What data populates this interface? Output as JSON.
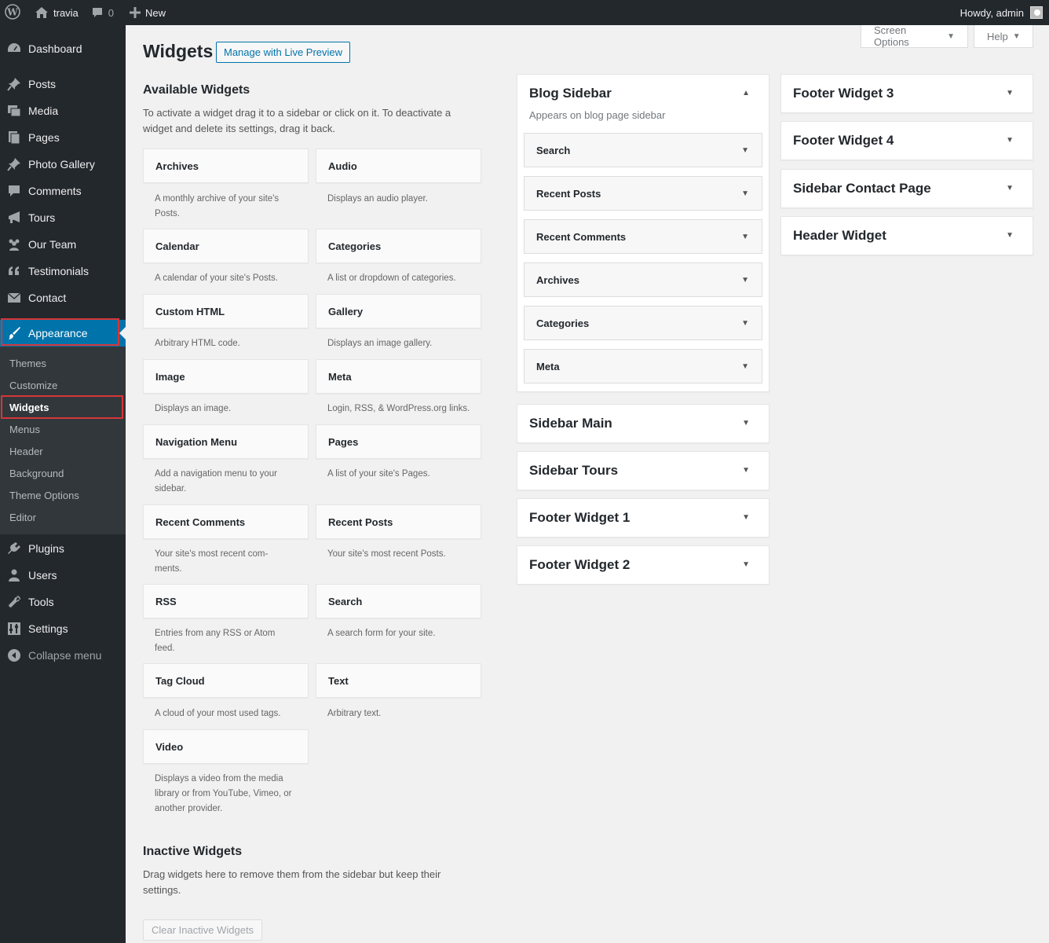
{
  "adminbar": {
    "site_name": "travia",
    "comments_count": "0",
    "new_label": "New",
    "howdy": "Howdy, admin"
  },
  "sidebar": {
    "items": [
      {
        "label": "Dashboard",
        "icon": "dashboard-icon"
      },
      {
        "label": "Posts",
        "icon": "pushpin-icon"
      },
      {
        "label": "Media",
        "icon": "media-icon"
      },
      {
        "label": "Pages",
        "icon": "pages-icon"
      },
      {
        "label": "Photo Gallery",
        "icon": "pushpin-icon"
      },
      {
        "label": "Comments",
        "icon": "comment-icon"
      },
      {
        "label": "Tours",
        "icon": "megaphone-icon"
      },
      {
        "label": "Our Team",
        "icon": "groups-icon"
      },
      {
        "label": "Testimonials",
        "icon": "quote-icon"
      },
      {
        "label": "Contact",
        "icon": "envelope-icon"
      },
      {
        "label": "Appearance",
        "icon": "paintbrush-icon"
      },
      {
        "label": "Plugins",
        "icon": "plugin-icon"
      },
      {
        "label": "Users",
        "icon": "user-icon"
      },
      {
        "label": "Tools",
        "icon": "wrench-icon"
      },
      {
        "label": "Settings",
        "icon": "settings-icon"
      },
      {
        "label": "Collapse menu",
        "icon": "collapse-icon"
      }
    ],
    "submenu": [
      "Themes",
      "Customize",
      "Widgets",
      "Menus",
      "Header",
      "Background",
      "Theme Options",
      "Editor"
    ]
  },
  "header": {
    "screen_options": "Screen Options",
    "help": "Help",
    "title": "Widgets",
    "live_preview": "Manage with Live Preview"
  },
  "available": {
    "title": "Available Widgets",
    "desc": "To activate a widget drag it to a sidebar or click on it. To deactivate a widget and delete its settings, drag it back.",
    "widgets": [
      {
        "name": "Archives",
        "desc": "A monthly archive of your site's Posts."
      },
      {
        "name": "Audio",
        "desc": "Displays an audio player."
      },
      {
        "name": "Calendar",
        "desc": "A calendar of your site's Posts."
      },
      {
        "name": "Categories",
        "desc": "A list or dropdown of categories."
      },
      {
        "name": "Custom HTML",
        "desc": "Arbitrary HTML code."
      },
      {
        "name": "Gallery",
        "desc": "Displays an image gallery."
      },
      {
        "name": "Image",
        "desc": "Displays an image."
      },
      {
        "name": "Meta",
        "desc": "Login, RSS, & WordPress.org links."
      },
      {
        "name": "Navigation Menu",
        "desc": "Add a navigation menu to your sidebar."
      },
      {
        "name": "Pages",
        "desc": "A list of your site's Pages."
      },
      {
        "name": "Recent Comments",
        "desc": "Your site's most recent com-ments."
      },
      {
        "name": "Recent Posts",
        "desc": "Your site's most recent Posts."
      },
      {
        "name": "RSS",
        "desc": "Entries from any RSS or Atom feed."
      },
      {
        "name": "Search",
        "desc": "A search form for your site."
      },
      {
        "name": "Tag Cloud",
        "desc": "A cloud of your most used tags."
      },
      {
        "name": "Text",
        "desc": "Arbitrary text."
      },
      {
        "name": "Video",
        "desc": "Displays a video from the media library or from YouTube, Vimeo, or another provider."
      }
    ]
  },
  "inactive": {
    "title": "Inactive Widgets",
    "desc": "Drag widgets here to remove them from the sidebar but keep their settings.",
    "clear_label": "Clear Inactive Widgets"
  },
  "sidebars_col1": [
    {
      "name": "Blog Sidebar",
      "desc": "Appears on blog page sidebar",
      "open": true,
      "widgets": [
        "Search",
        "Recent Posts",
        "Recent Comments",
        "Archives",
        "Categories",
        "Meta"
      ]
    },
    {
      "name": "Sidebar Main"
    },
    {
      "name": "Sidebar Tours"
    },
    {
      "name": "Footer Widget 1"
    },
    {
      "name": "Footer Widget 2"
    }
  ],
  "sidebars_col2": [
    {
      "name": "Footer Widget 3"
    },
    {
      "name": "Footer Widget 4"
    },
    {
      "name": "Sidebar Contact Page"
    },
    {
      "name": "Header Widget"
    }
  ],
  "colors": {
    "accent": "#0073aa",
    "adminbar": "#23282d",
    "highlight": "#d63638"
  }
}
